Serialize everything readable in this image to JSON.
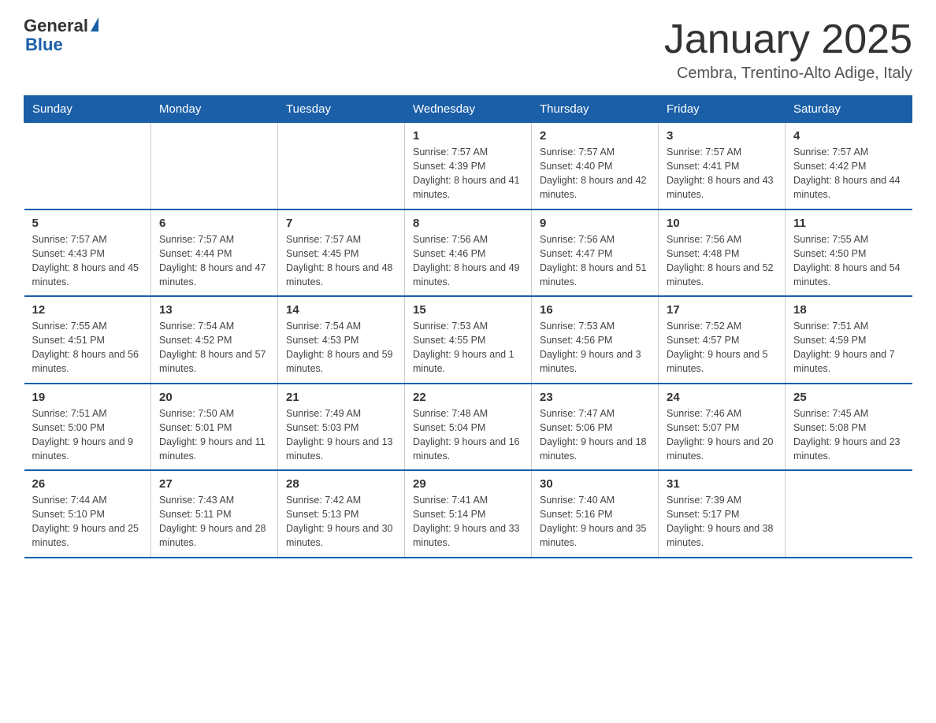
{
  "header": {
    "logo_general": "General",
    "logo_blue": "Blue",
    "month_title": "January 2025",
    "location": "Cembra, Trentino-Alto Adige, Italy"
  },
  "days_of_week": [
    "Sunday",
    "Monday",
    "Tuesday",
    "Wednesday",
    "Thursday",
    "Friday",
    "Saturday"
  ],
  "weeks": [
    [
      {
        "day": "",
        "info": ""
      },
      {
        "day": "",
        "info": ""
      },
      {
        "day": "",
        "info": ""
      },
      {
        "day": "1",
        "info": "Sunrise: 7:57 AM\nSunset: 4:39 PM\nDaylight: 8 hours and 41 minutes."
      },
      {
        "day": "2",
        "info": "Sunrise: 7:57 AM\nSunset: 4:40 PM\nDaylight: 8 hours and 42 minutes."
      },
      {
        "day": "3",
        "info": "Sunrise: 7:57 AM\nSunset: 4:41 PM\nDaylight: 8 hours and 43 minutes."
      },
      {
        "day": "4",
        "info": "Sunrise: 7:57 AM\nSunset: 4:42 PM\nDaylight: 8 hours and 44 minutes."
      }
    ],
    [
      {
        "day": "5",
        "info": "Sunrise: 7:57 AM\nSunset: 4:43 PM\nDaylight: 8 hours and 45 minutes."
      },
      {
        "day": "6",
        "info": "Sunrise: 7:57 AM\nSunset: 4:44 PM\nDaylight: 8 hours and 47 minutes."
      },
      {
        "day": "7",
        "info": "Sunrise: 7:57 AM\nSunset: 4:45 PM\nDaylight: 8 hours and 48 minutes."
      },
      {
        "day": "8",
        "info": "Sunrise: 7:56 AM\nSunset: 4:46 PM\nDaylight: 8 hours and 49 minutes."
      },
      {
        "day": "9",
        "info": "Sunrise: 7:56 AM\nSunset: 4:47 PM\nDaylight: 8 hours and 51 minutes."
      },
      {
        "day": "10",
        "info": "Sunrise: 7:56 AM\nSunset: 4:48 PM\nDaylight: 8 hours and 52 minutes."
      },
      {
        "day": "11",
        "info": "Sunrise: 7:55 AM\nSunset: 4:50 PM\nDaylight: 8 hours and 54 minutes."
      }
    ],
    [
      {
        "day": "12",
        "info": "Sunrise: 7:55 AM\nSunset: 4:51 PM\nDaylight: 8 hours and 56 minutes."
      },
      {
        "day": "13",
        "info": "Sunrise: 7:54 AM\nSunset: 4:52 PM\nDaylight: 8 hours and 57 minutes."
      },
      {
        "day": "14",
        "info": "Sunrise: 7:54 AM\nSunset: 4:53 PM\nDaylight: 8 hours and 59 minutes."
      },
      {
        "day": "15",
        "info": "Sunrise: 7:53 AM\nSunset: 4:55 PM\nDaylight: 9 hours and 1 minute."
      },
      {
        "day": "16",
        "info": "Sunrise: 7:53 AM\nSunset: 4:56 PM\nDaylight: 9 hours and 3 minutes."
      },
      {
        "day": "17",
        "info": "Sunrise: 7:52 AM\nSunset: 4:57 PM\nDaylight: 9 hours and 5 minutes."
      },
      {
        "day": "18",
        "info": "Sunrise: 7:51 AM\nSunset: 4:59 PM\nDaylight: 9 hours and 7 minutes."
      }
    ],
    [
      {
        "day": "19",
        "info": "Sunrise: 7:51 AM\nSunset: 5:00 PM\nDaylight: 9 hours and 9 minutes."
      },
      {
        "day": "20",
        "info": "Sunrise: 7:50 AM\nSunset: 5:01 PM\nDaylight: 9 hours and 11 minutes."
      },
      {
        "day": "21",
        "info": "Sunrise: 7:49 AM\nSunset: 5:03 PM\nDaylight: 9 hours and 13 minutes."
      },
      {
        "day": "22",
        "info": "Sunrise: 7:48 AM\nSunset: 5:04 PM\nDaylight: 9 hours and 16 minutes."
      },
      {
        "day": "23",
        "info": "Sunrise: 7:47 AM\nSunset: 5:06 PM\nDaylight: 9 hours and 18 minutes."
      },
      {
        "day": "24",
        "info": "Sunrise: 7:46 AM\nSunset: 5:07 PM\nDaylight: 9 hours and 20 minutes."
      },
      {
        "day": "25",
        "info": "Sunrise: 7:45 AM\nSunset: 5:08 PM\nDaylight: 9 hours and 23 minutes."
      }
    ],
    [
      {
        "day": "26",
        "info": "Sunrise: 7:44 AM\nSunset: 5:10 PM\nDaylight: 9 hours and 25 minutes."
      },
      {
        "day": "27",
        "info": "Sunrise: 7:43 AM\nSunset: 5:11 PM\nDaylight: 9 hours and 28 minutes."
      },
      {
        "day": "28",
        "info": "Sunrise: 7:42 AM\nSunset: 5:13 PM\nDaylight: 9 hours and 30 minutes."
      },
      {
        "day": "29",
        "info": "Sunrise: 7:41 AM\nSunset: 5:14 PM\nDaylight: 9 hours and 33 minutes."
      },
      {
        "day": "30",
        "info": "Sunrise: 7:40 AM\nSunset: 5:16 PM\nDaylight: 9 hours and 35 minutes."
      },
      {
        "day": "31",
        "info": "Sunrise: 7:39 AM\nSunset: 5:17 PM\nDaylight: 9 hours and 38 minutes."
      },
      {
        "day": "",
        "info": ""
      }
    ]
  ]
}
